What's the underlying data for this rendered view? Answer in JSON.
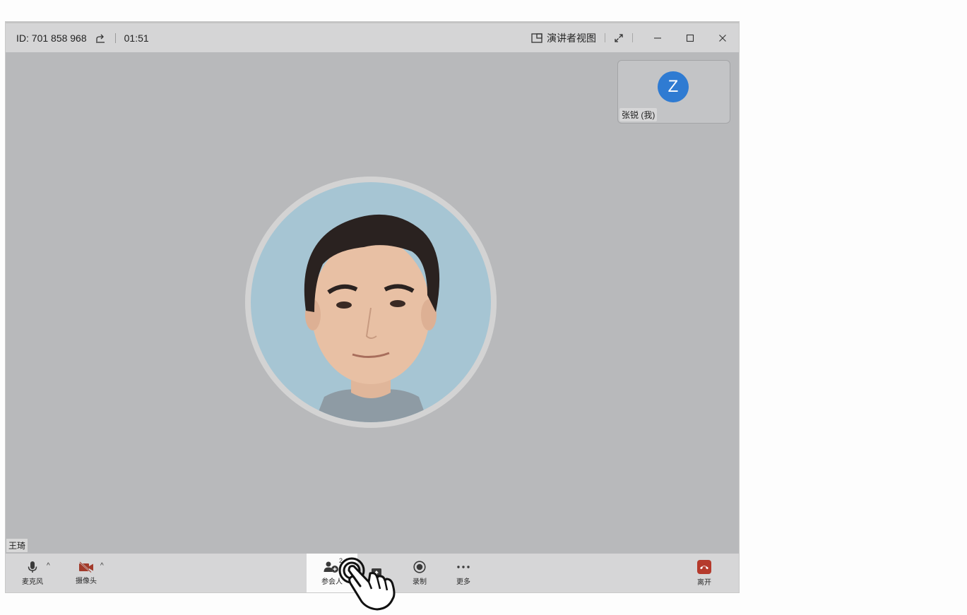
{
  "titlebar": {
    "meeting_id": "ID:  701 858 968",
    "timer": "01:51",
    "presenter_view_label": "演讲者视图"
  },
  "participants": {
    "self_initial": "Z",
    "self_name": "张锐 (我)",
    "main_name": "王琦"
  },
  "toolbar": {
    "mic_label": "麦克风",
    "camera_label": "摄像头",
    "participants_label": "参会人",
    "participants_count": "2",
    "record_label": "录制",
    "more_label": "更多",
    "leave_label": "离开"
  },
  "colors": {
    "avatar_blue": "#2f7bd2",
    "camera_off_red": "#a23a2a",
    "leave_red": "#b53a2c",
    "stage_gray": "#b8b9bb"
  }
}
